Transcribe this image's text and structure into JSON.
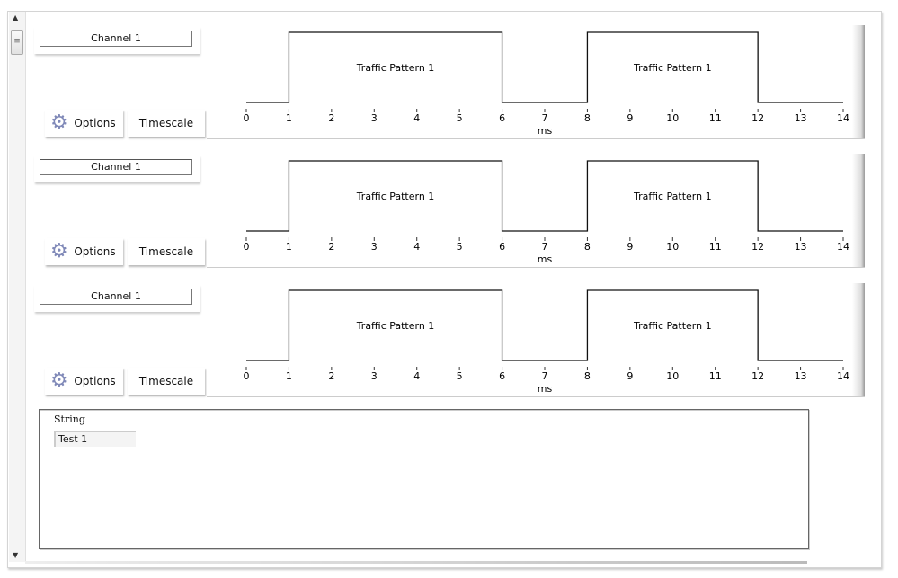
{
  "rows": [
    {
      "channel": "Channel 1",
      "options_label": "Options",
      "timescale_label": "Timescale"
    },
    {
      "channel": "Channel 1",
      "options_label": "Options",
      "timescale_label": "Timescale"
    },
    {
      "channel": "Channel 1",
      "options_label": "Options",
      "timescale_label": "Timescale"
    }
  ],
  "icons": {
    "options": "gear-icon",
    "scroll_up": "arrow-up-icon",
    "scroll_down": "arrow-down-icon",
    "thumb": "grip-icon"
  },
  "chart_data": {
    "type": "line",
    "xlabel": "ms",
    "xlim": [
      0,
      14
    ],
    "ticks": [
      "0",
      "1",
      "2",
      "3",
      "4",
      "5",
      "6",
      "7",
      "8",
      "9",
      "10",
      "11",
      "12",
      "13",
      "14"
    ],
    "waveform": [
      [
        0,
        0
      ],
      [
        1,
        0
      ],
      [
        1,
        1
      ],
      [
        6,
        1
      ],
      [
        6,
        0
      ],
      [
        8,
        0
      ],
      [
        8,
        1
      ],
      [
        12,
        1
      ],
      [
        12,
        0
      ],
      [
        14,
        0
      ]
    ],
    "patterns": [
      {
        "label": "Traffic Pattern 1",
        "start": 1,
        "end": 6
      },
      {
        "label": "Traffic Pattern 1",
        "start": 8,
        "end": 12
      }
    ]
  },
  "string_control": {
    "label": "String",
    "value": "Test 1"
  }
}
